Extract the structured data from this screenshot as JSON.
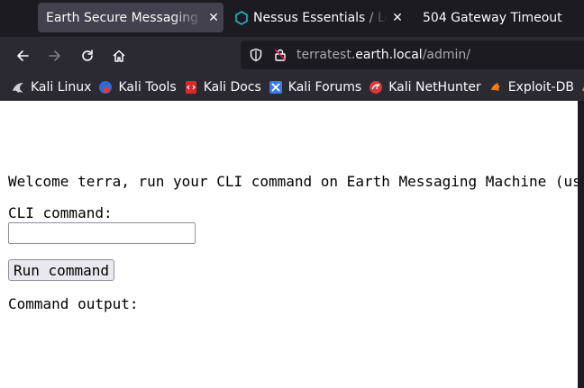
{
  "browser": {
    "tabs": [
      {
        "title": "Earth Secure Messaging Ad",
        "active": true,
        "favicon": "none"
      },
      {
        "title": "Nessus Essentials / Logi",
        "active": false,
        "favicon": "nessus-icon"
      },
      {
        "title": "504 Gateway Timeout",
        "active": false,
        "favicon": "none"
      }
    ],
    "url": {
      "host_pre": "terratest.",
      "host": "earth.local",
      "path": "/admin/"
    },
    "bookmarks": [
      {
        "label": "Kali Linux",
        "icon": "kali-dragon-icon"
      },
      {
        "label": "Kali Tools",
        "icon": "kali-tools-icon"
      },
      {
        "label": "Kali Docs",
        "icon": "kali-docs-icon"
      },
      {
        "label": "Kali Forums",
        "icon": "kali-forums-icon"
      },
      {
        "label": "Kali NetHunter",
        "icon": "kali-nethunter-icon"
      },
      {
        "label": "Exploit-DB",
        "icon": "exploit-db-icon"
      }
    ]
  },
  "page": {
    "welcome": "Welcome terra, run your CLI command on Earth Messaging Machine (use",
    "cli_label": "CLI command:",
    "cli_value": "",
    "run_button": "Run command",
    "output_label": "Command output:"
  },
  "colors": {
    "tabstrip_bg": "#1c1b22",
    "toolbar_bg": "#2b2a33",
    "active_tab_bg": "#42414d",
    "page_bg": "#ffffff"
  }
}
